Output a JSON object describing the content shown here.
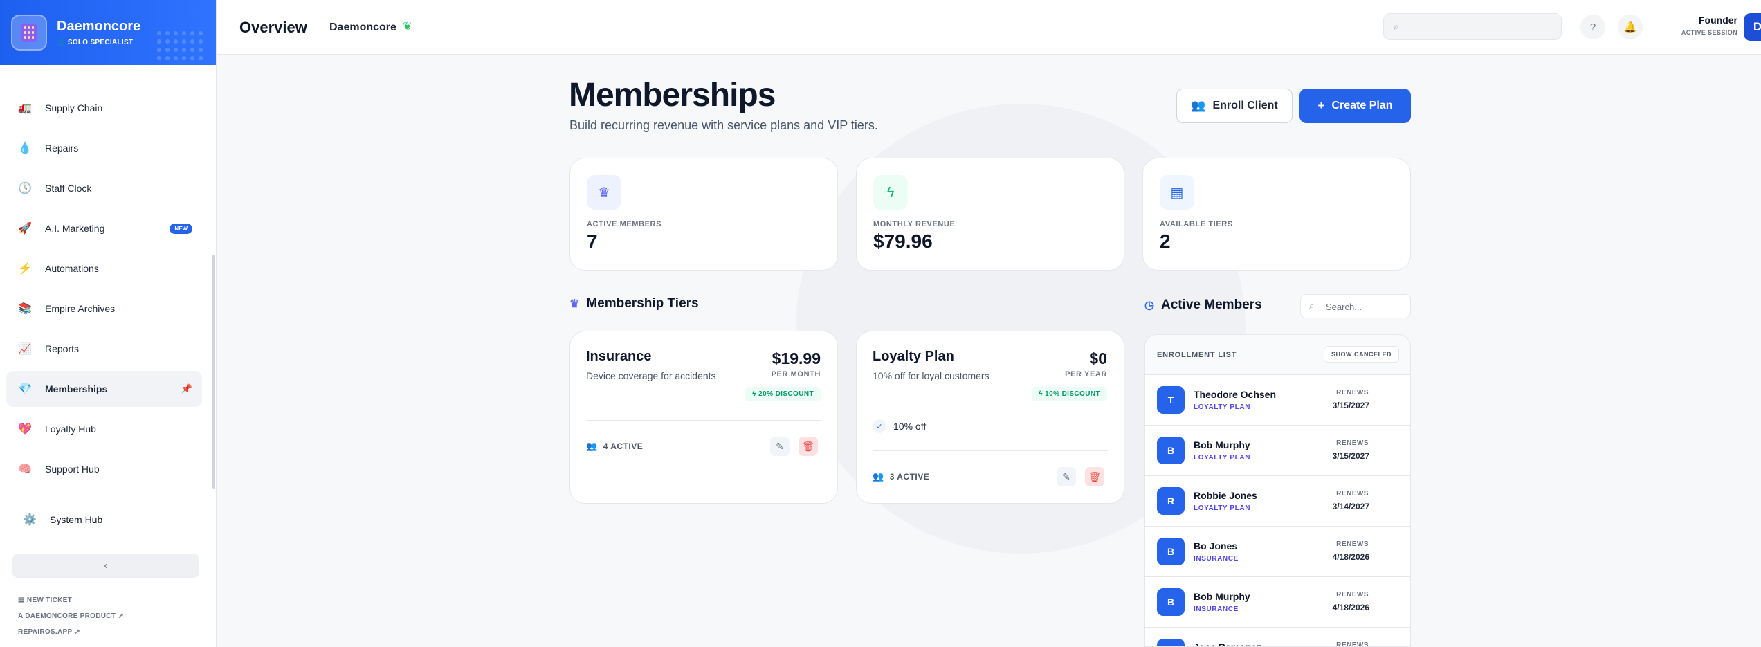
{
  "brand": {
    "name": "Daemoncore",
    "role": "SOLO SPECIALIST"
  },
  "nav": [
    {
      "label": "Supply Chain",
      "icon": "truck-icon",
      "glyph": "🚛"
    },
    {
      "label": "Repairs",
      "icon": "droplet-icon",
      "glyph": "💧"
    },
    {
      "label": "Staff Clock",
      "icon": "clock-icon",
      "glyph": "🕓"
    },
    {
      "label": "A.I. Marketing",
      "icon": "rocket-icon",
      "glyph": "🚀",
      "badge": "NEW"
    },
    {
      "label": "Automations",
      "icon": "bolt-icon",
      "glyph": "⚡"
    },
    {
      "label": "Empire Archives",
      "icon": "books-icon",
      "glyph": "📚"
    },
    {
      "label": "Reports",
      "icon": "chart-icon",
      "glyph": "📈"
    },
    {
      "label": "Memberships",
      "icon": "gem-icon",
      "glyph": "💎",
      "active": true
    },
    {
      "label": "Loyalty Hub",
      "icon": "heart-icon",
      "glyph": "💖"
    },
    {
      "label": "Support Hub",
      "icon": "brain-icon",
      "glyph": "🧠"
    }
  ],
  "system": {
    "label": "System Hub",
    "glyph": "⚙️"
  },
  "footer": {
    "ticket": "NEW TICKET",
    "product": "A DAEMONCORE PRODUCT",
    "site": "REPAIROS.APP"
  },
  "topbar": {
    "title": "Overview",
    "workspace": "Daemoncore",
    "user_name": "Founder",
    "user_role": "ACTIVE SESSION",
    "avatar": "D"
  },
  "page": {
    "title": "Memberships",
    "subtitle": "Build recurring revenue with service plans and VIP tiers.",
    "enroll": "Enroll Client",
    "create": "Create Plan"
  },
  "stats": [
    {
      "label": "ACTIVE MEMBERS",
      "value": "7",
      "icon": "crown-icon",
      "color": "#6366f1"
    },
    {
      "label": "MONTHLY REVENUE",
      "value": "$79.96",
      "icon": "bolt-icon",
      "color": "#10b981"
    },
    {
      "label": "AVAILABLE TIERS",
      "value": "2",
      "icon": "calendar-icon",
      "color": "#2563eb"
    }
  ],
  "tiers_section": "Membership Tiers",
  "tiers": [
    {
      "name": "Insurance",
      "desc": "Device coverage for accidents",
      "price": "$19.99",
      "period": "PER MONTH",
      "discount": "20% DISCOUNT",
      "active": "4 ACTIVE"
    },
    {
      "name": "Loyalty Plan",
      "desc": "10% off for loyal customers",
      "price": "$0",
      "period": "PER YEAR",
      "discount": "10% DISCOUNT",
      "feature": "10% off",
      "active": "3 ACTIVE"
    }
  ],
  "members_section": "Active Members",
  "members_search": "Search...",
  "enrollment": {
    "label": "ENROLLMENT LIST",
    "toggle": "SHOW CANCELED",
    "renews_label": "RENEWS"
  },
  "members": [
    {
      "initial": "T",
      "name": "Theodore Ochsen",
      "plan": "LOYALTY PLAN",
      "date": "3/15/2027"
    },
    {
      "initial": "B",
      "name": "Bob Murphy",
      "plan": "LOYALTY PLAN",
      "date": "3/15/2027"
    },
    {
      "initial": "R",
      "name": "Robbie Jones",
      "plan": "LOYALTY PLAN",
      "date": "3/14/2027"
    },
    {
      "initial": "B",
      "name": "Bo Jones",
      "plan": "INSURANCE",
      "date": "4/18/2026"
    },
    {
      "initial": "B",
      "name": "Bob Murphy",
      "plan": "INSURANCE",
      "date": "4/18/2026"
    },
    {
      "initial": "J",
      "name": "Jose Ramonez",
      "plan": "",
      "date": ""
    }
  ]
}
